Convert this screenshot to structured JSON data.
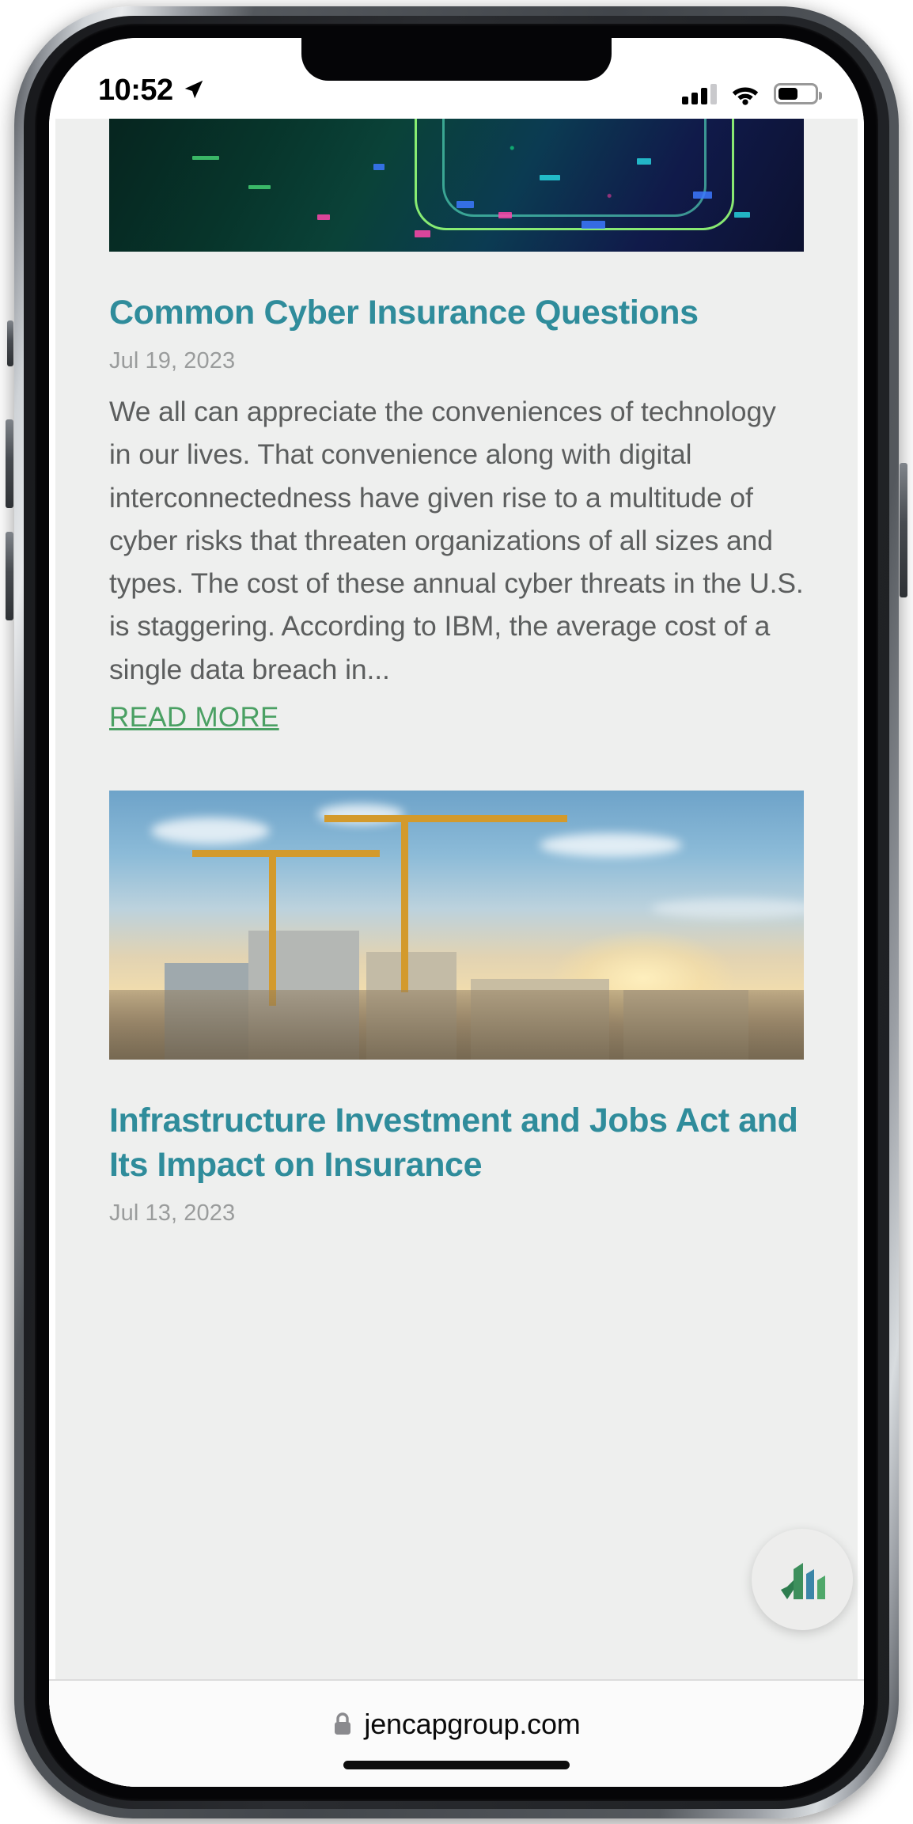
{
  "device": {
    "status_bar": {
      "time": "10:52",
      "location_icon": "location-arrow-icon",
      "cellular_icon": "cellular-signal-icon",
      "cellular_bars_filled": 3,
      "cellular_bars_total": 4,
      "wifi_icon": "wifi-icon",
      "battery_icon": "battery-icon",
      "battery_level_percent": 47
    },
    "home_indicator": "home-indicator"
  },
  "browser": {
    "name": "safari",
    "lock_icon": "lock-icon",
    "url": "jencapgroup.com"
  },
  "theme": {
    "page_background": "#eeefee",
    "title_teal": "#2f8c9b",
    "body_gray": "#5c5e5e",
    "date_gray": "#9a9c9c",
    "link_green": "#4aa063",
    "fab_background": "#ededec"
  },
  "main": {
    "articles": [
      {
        "image_alt": "cyber-circuit-board-image",
        "title": "Common Cyber Insurance Questions",
        "date": "Jul 19, 2023",
        "excerpt": "We all can appreciate the conveniences of technology in our lives. That convenience along with digital interconnectedness have given rise to a multitude of cyber risks that threaten organizations of all sizes and types. The cost of these annual cyber threats in the U.S. is staggering. According to IBM, the average cost of a single data breach in...",
        "read_more_label": "READ MORE"
      },
      {
        "image_alt": "construction-cranes-image",
        "title": "Infrastructure Investment and Jobs Act and Its Impact on Insurance",
        "date": "Jul 13, 2023",
        "excerpt": "",
        "read_more_label": ""
      }
    ]
  },
  "widget": {
    "name": "jencap-logo-badge",
    "logo_colors": [
      "#2e7d4f",
      "#3d8f5c",
      "#3b86a8",
      "#4fa86a"
    ]
  }
}
